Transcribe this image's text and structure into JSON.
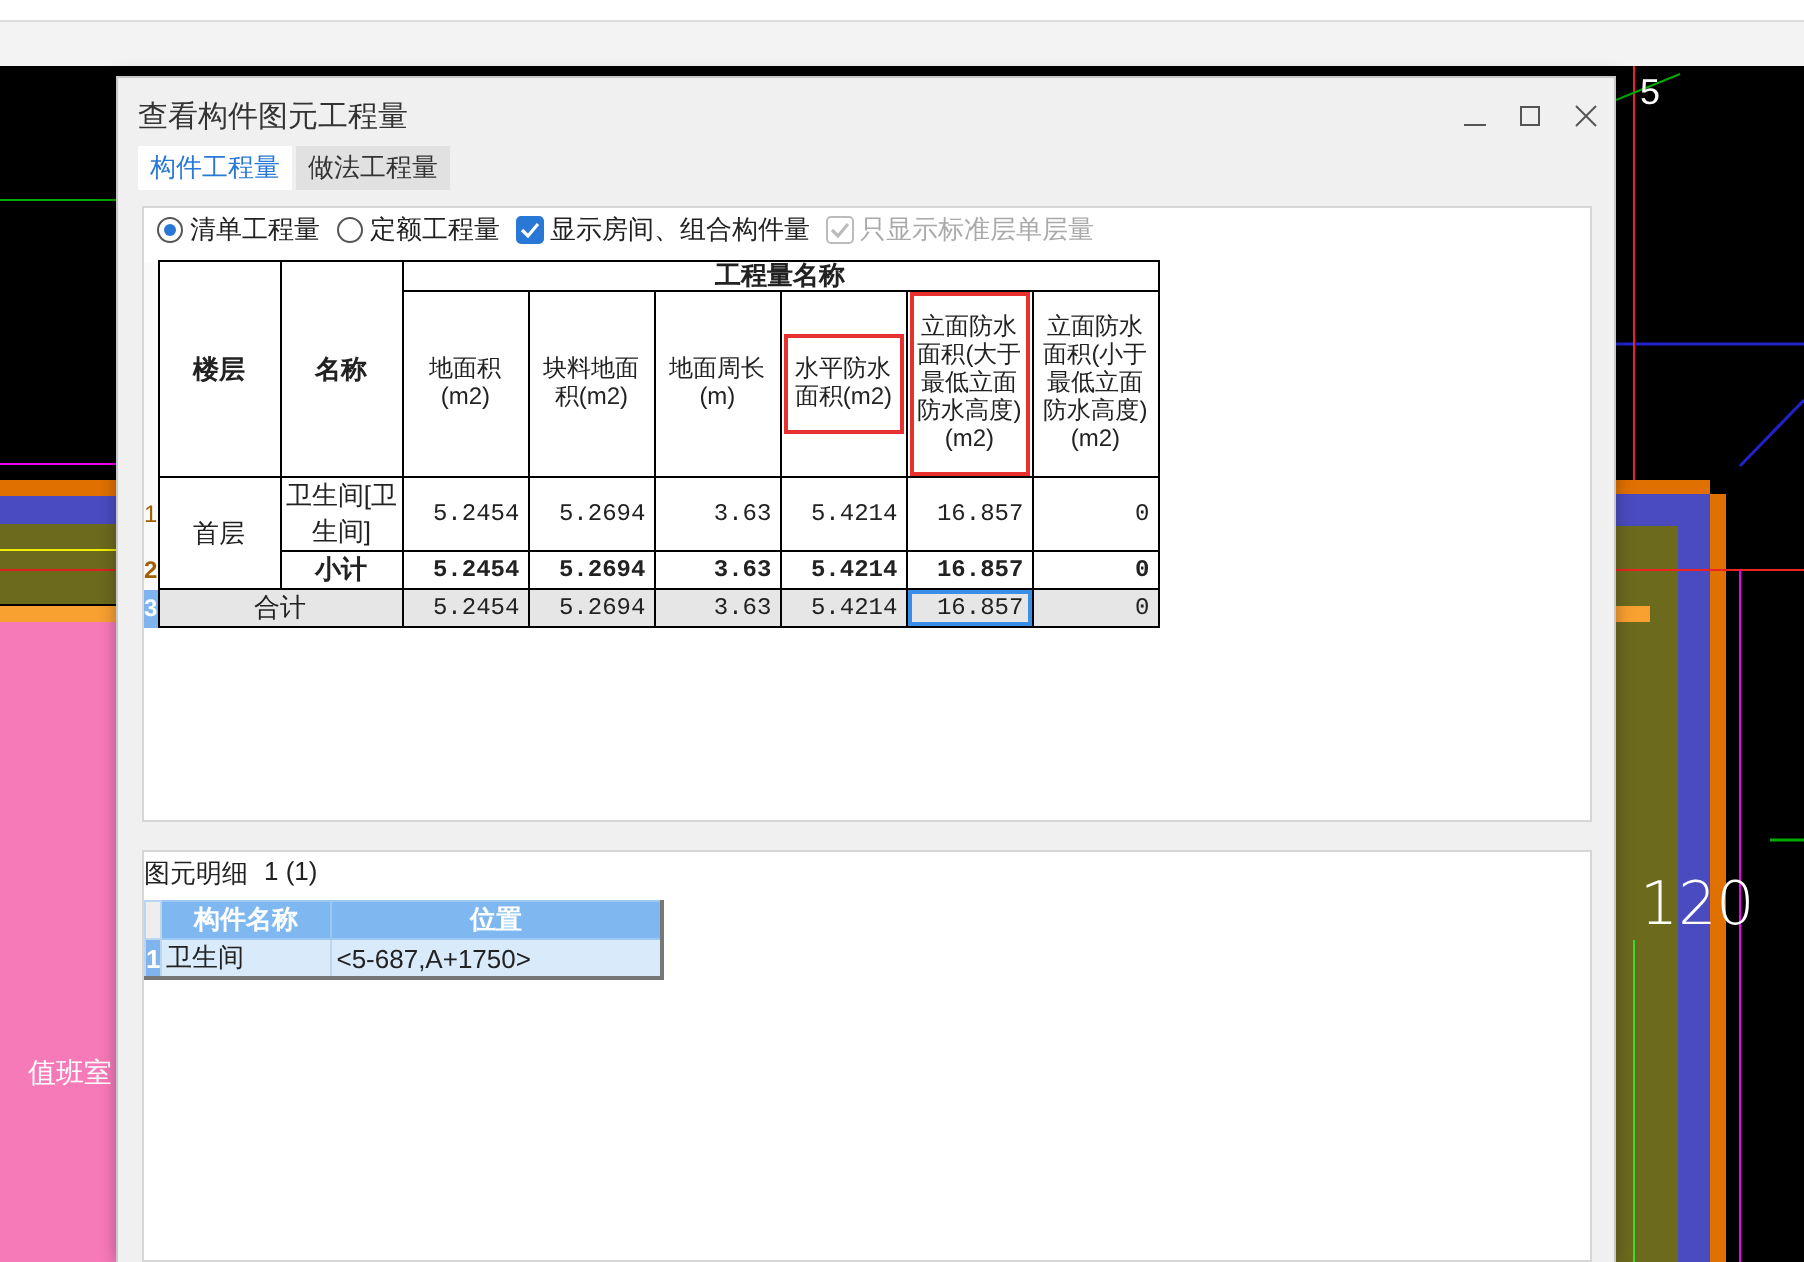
{
  "cad": {
    "labels": [
      {
        "text": "5"
      },
      {
        "text": "120"
      },
      {
        "text": "值班室"
      }
    ]
  },
  "window": {
    "title": "查看构件图元工程量"
  },
  "tabs": [
    {
      "label": "构件工程量",
      "selected": true
    },
    {
      "label": "做法工程量",
      "selected": false
    }
  ],
  "options": [
    {
      "kind": "radio",
      "label": "清单工程量",
      "checked": true,
      "disabled": false
    },
    {
      "kind": "radio",
      "label": "定额工程量",
      "checked": false,
      "disabled": false
    },
    {
      "kind": "checkbox",
      "label": "显示房间、组合构件量",
      "checked": true,
      "disabled": false
    },
    {
      "kind": "checkbox",
      "label": "只显示标准层单层量",
      "checked": true,
      "disabled": true
    }
  ],
  "quantity_table": {
    "columns": [
      {
        "label": "楼层"
      },
      {
        "label": "名称"
      }
    ],
    "group_header": "工程量名称",
    "quantity_columns": [
      {
        "label": "地面积(m2)",
        "highlighted": false
      },
      {
        "label": "块料地面积(m2)",
        "highlighted": false
      },
      {
        "label": "地面周长(m)",
        "highlighted": false
      },
      {
        "label": "水平防水面积(m2)",
        "highlighted": true
      },
      {
        "label": "立面防水面积(大于最低立面防水高度)(m2)",
        "highlighted": true
      },
      {
        "label": "立面防水面积(小于最低立面防水高度)(m2)",
        "highlighted": false
      }
    ],
    "rows": [
      {
        "number": "1",
        "kind": "item",
        "selected": false,
        "floor": "首层",
        "name": "卫生间[卫生间]",
        "values": [
          {
            "text": "5.2454",
            "selected": false
          },
          {
            "text": "5.2694",
            "selected": false
          },
          {
            "text": "3.63",
            "selected": false
          },
          {
            "text": "5.4214",
            "selected": false
          },
          {
            "text": "16.857",
            "selected": false
          },
          {
            "text": "0",
            "selected": false
          }
        ]
      },
      {
        "number": "2",
        "kind": "subtotal",
        "selected": false,
        "name": "小计",
        "values": [
          {
            "text": "5.2454",
            "selected": false
          },
          {
            "text": "5.2694",
            "selected": false
          },
          {
            "text": "3.63",
            "selected": false
          },
          {
            "text": "5.4214",
            "selected": false
          },
          {
            "text": "16.857",
            "selected": false
          },
          {
            "text": "0",
            "selected": false
          }
        ]
      },
      {
        "number": "3",
        "kind": "total",
        "selected": true,
        "name": "合计",
        "values": [
          {
            "text": "5.2454",
            "selected": false
          },
          {
            "text": "5.2694",
            "selected": false
          },
          {
            "text": "3.63",
            "selected": false
          },
          {
            "text": "5.4214",
            "selected": false
          },
          {
            "text": "16.857",
            "selected": true
          },
          {
            "text": "0",
            "selected": false
          }
        ]
      }
    ]
  },
  "detail": {
    "title": "图元明细",
    "count": "1 (1)",
    "columns": [
      {
        "label": "构件名称"
      },
      {
        "label": "位置"
      }
    ],
    "rows": [
      {
        "number": "1",
        "selected": true,
        "cells": [
          "卫生间",
          "<5-687,A+1750>"
        ]
      }
    ]
  }
}
